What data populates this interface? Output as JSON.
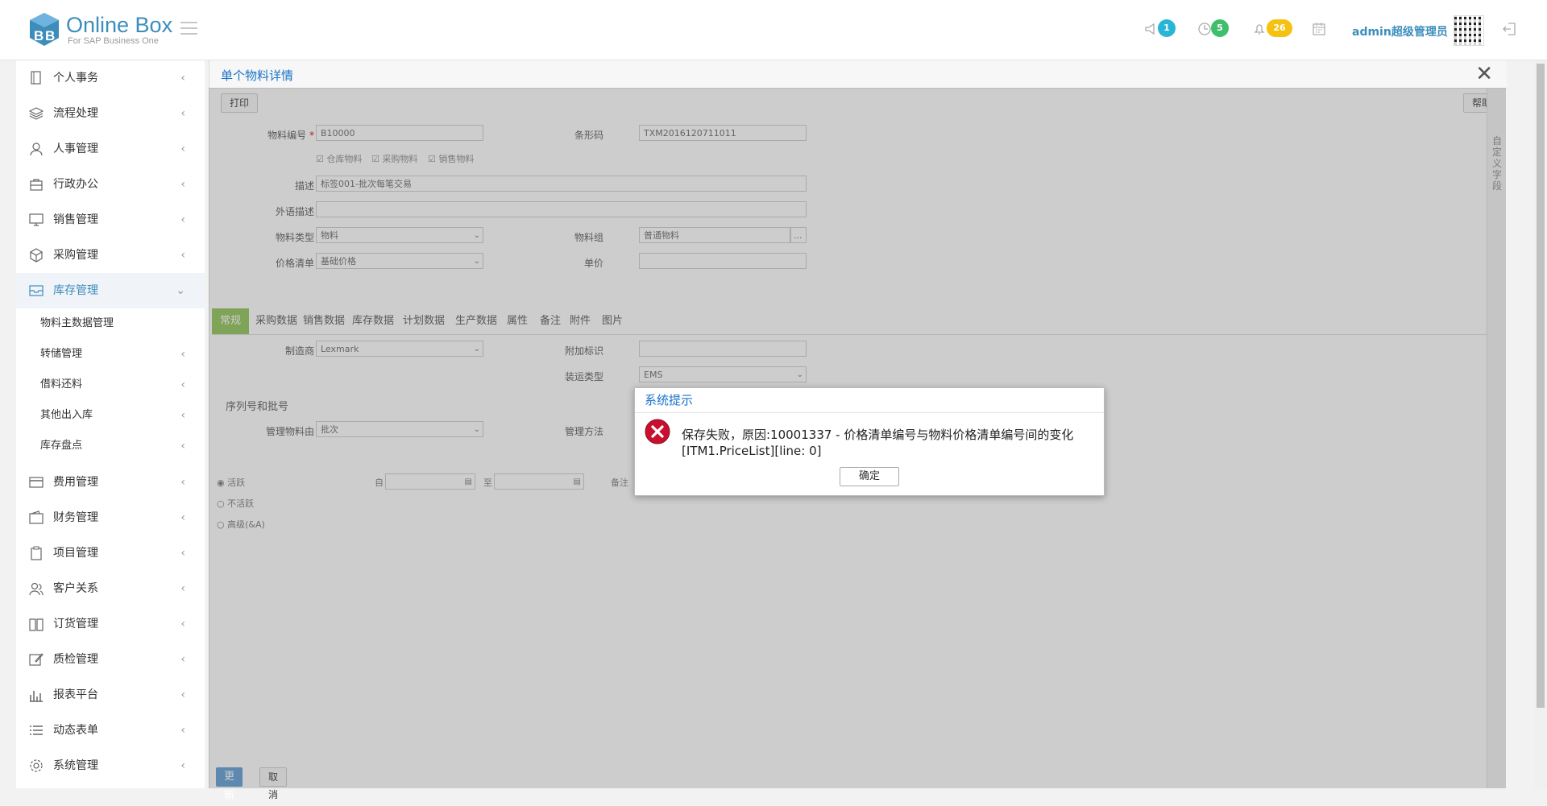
{
  "app": {
    "brand": "Online Box",
    "brand_sub": "For SAP Business One"
  },
  "header": {
    "badges": {
      "announce": "1",
      "clock": "5",
      "bell": "26"
    },
    "colors": {
      "announce": "#28b6d6",
      "clock": "#3fbf6b",
      "bell": "#f5c212"
    },
    "user": "admin超级管理员"
  },
  "sidebar": {
    "items": [
      {
        "label": "个人事务",
        "icon": "document-icon"
      },
      {
        "label": "流程处理",
        "icon": "layers-icon"
      },
      {
        "label": "人事管理",
        "icon": "person-icon"
      },
      {
        "label": "行政办公",
        "icon": "briefcase-icon"
      },
      {
        "label": "销售管理",
        "icon": "monitor-icon"
      },
      {
        "label": "采购管理",
        "icon": "cubes-icon"
      },
      {
        "label": "库存管理",
        "icon": "inbox-icon"
      }
    ],
    "subitems": [
      {
        "label": "物料主数据管理"
      },
      {
        "label": "转储管理"
      },
      {
        "label": "借料还料"
      },
      {
        "label": "其他出入库"
      },
      {
        "label": "库存盘点"
      }
    ],
    "items2": [
      {
        "label": "费用管理",
        "icon": "card-icon"
      },
      {
        "label": "财务管理",
        "icon": "wallet-icon"
      },
      {
        "label": "项目管理",
        "icon": "clipboard-icon"
      },
      {
        "label": "客户关系",
        "icon": "users-icon"
      },
      {
        "label": "订货管理",
        "icon": "book-icon"
      },
      {
        "label": "质检管理",
        "icon": "edit-icon"
      },
      {
        "label": "报表平台",
        "icon": "bar-chart-icon"
      },
      {
        "label": "动态表单",
        "icon": "list-icon"
      },
      {
        "label": "系统管理",
        "icon": "gear-icon"
      }
    ]
  },
  "panel": {
    "title": "单个物料详情",
    "print": "打印",
    "help": "帮助",
    "custom_fields": "自定义字段"
  },
  "form": {
    "item_code_label": "物料编号",
    "item_code_required": "*",
    "item_code": "B10000",
    "barcode_label": "条形码",
    "barcode": "TXM2016120711011",
    "chk_inventory": "仓库物料",
    "chk_purchase": "采购物料",
    "chk_sales": "销售物料",
    "desc_label": "描述",
    "desc": "标签001-批次每笔交易",
    "foreign_desc_label": "外语描述",
    "foreign_desc": "",
    "item_type_label": "物料类型",
    "item_type": "物料",
    "item_group_label": "物料组",
    "item_group": "普通物料",
    "item_group_btn": "...",
    "price_list_label": "价格清单",
    "price_list": "基础价格",
    "unit_price_label": "单价",
    "unit_price": ""
  },
  "tabs": [
    "常规",
    "采购数据",
    "销售数据",
    "库存数据",
    "计划数据",
    "生产数据",
    "属性",
    "备注",
    "附件",
    "图片"
  ],
  "general": {
    "manufacturer_label": "制造商",
    "manufacturer": "Lexmark",
    "extra_id_label": "附加标识",
    "extra_id": "",
    "shipping_type_label": "装运类型",
    "shipping_type": "EMS",
    "serial_batch_section": "序列号和批号",
    "manage_by_label": "管理物料由",
    "manage_by": "批次",
    "manage_method_label": "管理方法",
    "radio_active": "活跃",
    "radio_inactive": "不活跃",
    "radio_advanced": "高级(&A)",
    "from_label": "自",
    "to_label": "至",
    "remarks_label": "备注"
  },
  "footer": {
    "update": "更新",
    "cancel": "取消"
  },
  "dialog": {
    "title": "系统提示",
    "message": "保存失败，原因:10001337 - 价格清单编号与物料价格清单编号间的变化 [ITM1.PriceList][line: 0]",
    "ok": "确定"
  }
}
